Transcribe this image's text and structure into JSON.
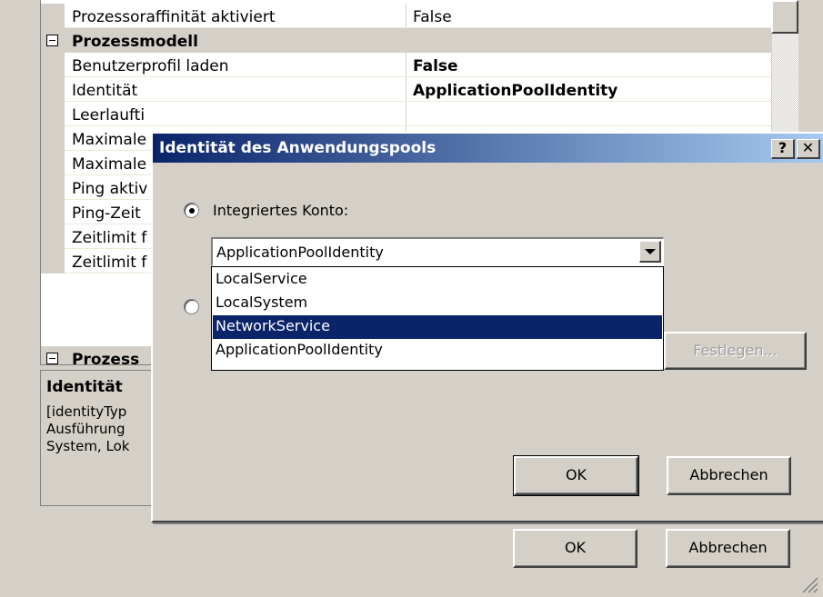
{
  "property_grid": {
    "rows": [
      {
        "type": "prop",
        "name": "Prozessoraffinität aktiviert",
        "value": "False",
        "bold_value": false
      },
      {
        "type": "category",
        "name": "Prozessmodell"
      },
      {
        "type": "prop",
        "name": "Benutzerprofil laden",
        "value": "False",
        "bold_value": true
      },
      {
        "type": "prop",
        "name": "Identität",
        "value": "ApplicationPoolIdentity",
        "bold_value": true
      },
      {
        "type": "prop",
        "name": "Leerlaufti",
        "value": ""
      },
      {
        "type": "prop",
        "name": "Maximale",
        "value": ""
      },
      {
        "type": "prop",
        "name": "Maximale",
        "value": ""
      },
      {
        "type": "prop",
        "name": "Ping aktiv",
        "value": ""
      },
      {
        "type": "prop",
        "name": "Ping-Zeit",
        "value": ""
      },
      {
        "type": "prop",
        "name": "Zeitlimit f",
        "value": ""
      },
      {
        "type": "prop",
        "name": "Zeitlimit f",
        "value": ""
      },
      {
        "type": "category",
        "name": "Prozess"
      }
    ]
  },
  "description": {
    "title": "Identität",
    "lines": [
      "[identityTyp",
      "Ausführung",
      "System, Lok"
    ]
  },
  "outer_buttons": {
    "ok": "OK",
    "cancel": "Abbrechen"
  },
  "dialog": {
    "title": "Identität des Anwendungspools",
    "help_label": "?",
    "close_label": "✕",
    "builtin_account_label": "Integriertes Konto:",
    "builtin_selected": true,
    "combo_value": "ApplicationPoolIdentity",
    "options": [
      "LocalService",
      "LocalSystem",
      "NetworkService",
      "ApplicationPoolIdentity"
    ],
    "highlighted_option_index": 2,
    "set_button": "Festlegen...",
    "ok": "OK",
    "cancel": "Abbrechen"
  }
}
